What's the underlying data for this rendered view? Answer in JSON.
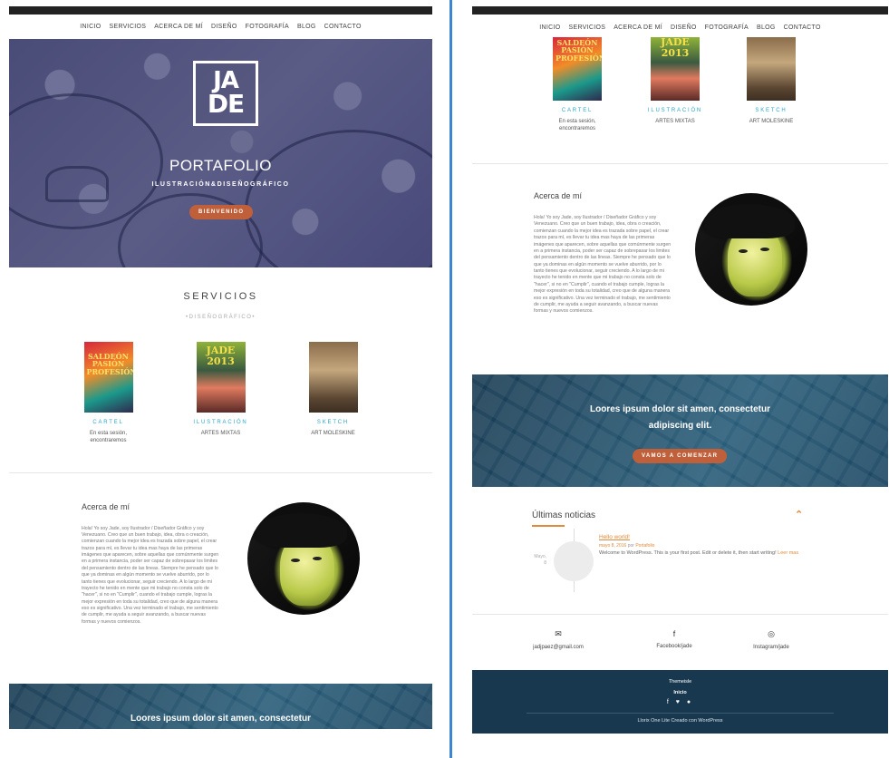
{
  "nav": [
    "INICIO",
    "SERVICIOS",
    "ACERCA DE MÍ",
    "DISEÑO",
    "FOTOGRAFÍA",
    "BLOG",
    "CONTACTO"
  ],
  "hero": {
    "logo_top": "JA",
    "logo_bottom": "DE",
    "title": "PORTAFOLIO",
    "subtitle": "ILUSTRACIÓN&DISEÑOGRÁFICO",
    "button": "BIENVENIDO"
  },
  "services": {
    "title": "SERVICIOS",
    "subtitle": "•DISEÑOGRÁFICO•",
    "items": [
      {
        "name": "CARTEL",
        "desc": "En esta sesión, encontraremos",
        "poster_text": "SALDEÓN PASIÓN PROFESIÓN"
      },
      {
        "name": "ILUSTRACIÓN",
        "desc": "ARTES MIXTAS",
        "poster_text": "JADE 2013"
      },
      {
        "name": "SKETCH",
        "desc": "ART MOLESKINE",
        "poster_text": ""
      }
    ]
  },
  "about": {
    "title": "Acerca de mí",
    "body": "Hola! Yo soy Jade, soy Ilustrador / Diseñador Gráfico y soy Venezuano. Creo que un buen trabajo, idea, obra o creación, comienzan cuando la mejor idea es trazada sobre papel, el crear trazos para mí, es llevar tu idea mas haya de las primeras imágenes que aparecen, sobre aquellas que comúnmente surgen en a primera instancia, poder ser capaz de sobrepasar los limites del pensamiento dentro de las lineas. Siempre he pensado que lo que ya dominas en algún momento se vuelve aburrido, por lo tanto tienes que evolucionar, seguir creciendo. A lo largo de mi trayecto he tenido en mente que mi trabajo no consta solo de \"hacer\", si no en \"Cumplir\", cuando el trabajo cumple, logras la mejor expresión en toda su totalidad, creo que de alguna manera eso es significativo. Una vez terminado el trabajo, me sentimiento de cumplir, me ayuda a seguir avanzando, a buscar nuevas formas y nuevos comienzos."
  },
  "banner": {
    "text_line1": "Loores ipsum dolor sit amen, consectetur",
    "text_line2": "adipiscing elit.",
    "button": "VAMOS A COMENZAR"
  },
  "news": {
    "title": "Últimas noticias",
    "date_month": "Mayo,",
    "date_day": "8",
    "post_title": "Hello world!",
    "post_date": "mayo 8, 2016",
    "post_by": "por",
    "post_author": "Portafolio",
    "post_excerpt": "Welcome to WordPress. This is your first post. Edit or delete it, then start writing!",
    "post_more": "Leer mas"
  },
  "contact": [
    {
      "icon": "✉",
      "label": "jadjpaez@gmail.com"
    },
    {
      "icon": "f",
      "label": "Facebook/jade"
    },
    {
      "icon": "◎",
      "label": "Instagram/jade"
    }
  ],
  "footer": {
    "line1": "Themeisle",
    "line2": "Inicio",
    "social": "f ♥ ●",
    "credits": "Llorix One Lite Creado con WordPress"
  },
  "colors": {
    "accent": "#c0603a",
    "link": "#e08a3c",
    "service": "#2aa6c9",
    "footer": "#18384f"
  }
}
